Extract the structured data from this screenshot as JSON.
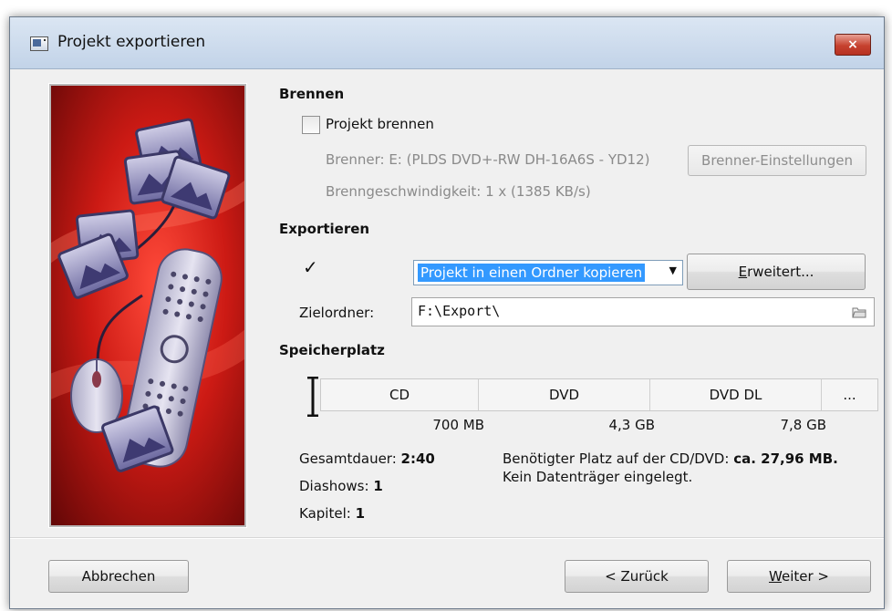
{
  "window": {
    "title": "Projekt exportieren",
    "close_glyph": "×"
  },
  "brennen": {
    "heading": "Brennen",
    "checkbox_label": "Projekt brennen",
    "burner": "Brenner: E: (PLDS DVD+-RW DH-16A6S - YD12)",
    "speed": "Brenngeschwindigkeit: 1 x (1385 KB/s)",
    "settings_button": "Brenner-Einstellungen"
  },
  "exportieren": {
    "heading": "Exportieren",
    "mode_selected": "Projekt in einen Ordner kopieren",
    "advanced_button_first": "E",
    "advanced_button_rest": "rweitert...",
    "target_label": "Zielordner:",
    "target_value": "F:\\Export\\"
  },
  "speicherplatz": {
    "heading": "Speicherplatz",
    "segments": [
      "CD",
      "DVD",
      "DVD DL",
      "..."
    ],
    "sizes": [
      "700 MB",
      "4,3 GB",
      "7,8 GB"
    ],
    "duration_label": "Gesamtdauer:",
    "duration_value": "2:40",
    "slideshows_label": "Diashows:",
    "slideshows_value": "1",
    "chapters_label": "Kapitel:",
    "chapters_value": "1",
    "needed_label": "Benötigter Platz auf der CD/DVD:",
    "needed_value": "ca. 27,96 MB.",
    "no_disc": "Kein Datenträger eingelegt."
  },
  "footer": {
    "cancel_button": "Abbrechen",
    "back_button": "< Zurück",
    "next_button_first": "W",
    "next_button_rest": "eiter >"
  },
  "colors": {
    "accent_selection": "#3399ff",
    "close_red": "#c6412f",
    "image_red": "#b81414"
  }
}
